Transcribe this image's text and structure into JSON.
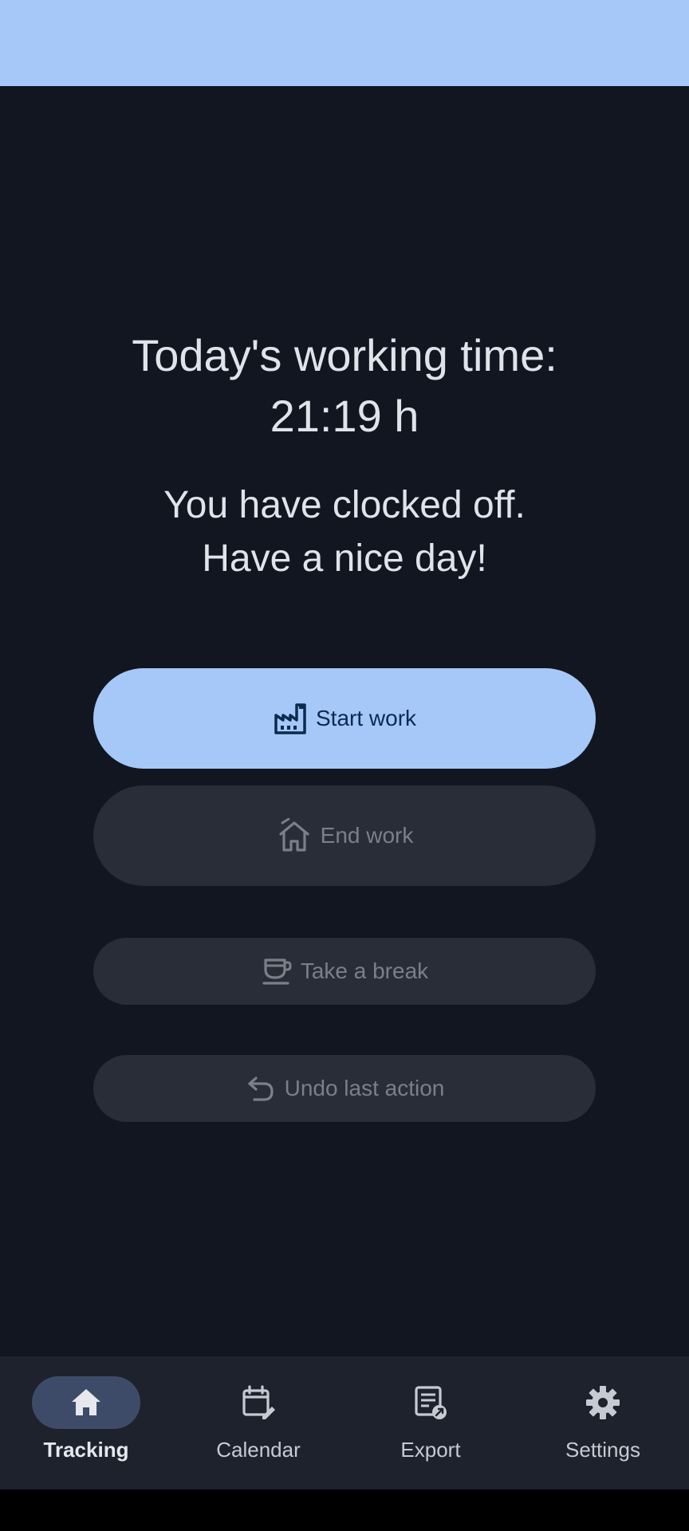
{
  "tracking": {
    "working_time_label": "Today's working time:",
    "working_time_value": "21:19 h",
    "status_line1": "You have clocked off.",
    "status_line2": "Have a nice day!"
  },
  "actions": {
    "start_work": "Start work",
    "end_work": "End work",
    "take_break": "Take a break",
    "undo": "Undo last action"
  },
  "nav": {
    "items": [
      {
        "label": "Tracking",
        "icon": "home-icon",
        "active": true
      },
      {
        "label": "Calendar",
        "icon": "calendar-edit-icon",
        "active": false
      },
      {
        "label": "Export",
        "icon": "export-icon",
        "active": false
      },
      {
        "label": "Settings",
        "icon": "gear-icon",
        "active": false
      }
    ]
  },
  "colors": {
    "accent": "#a5c8f8",
    "background": "#111620",
    "disabled_button": "#282d37",
    "nav_background": "#1d222c",
    "nav_active_pill": "#3e4b68"
  }
}
